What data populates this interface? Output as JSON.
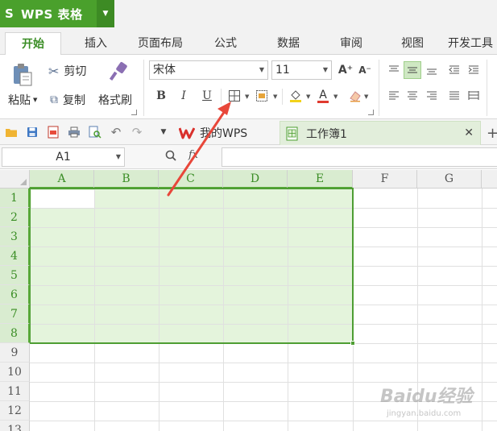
{
  "app": {
    "logo_glyph": "S",
    "name": "WPS 表格"
  },
  "tabs": [
    {
      "label": "开始",
      "active": true
    },
    {
      "label": "插入"
    },
    {
      "label": "页面布局"
    },
    {
      "label": "公式"
    },
    {
      "label": "数据"
    },
    {
      "label": "审阅"
    },
    {
      "label": "视图"
    },
    {
      "label": "开发工具"
    }
  ],
  "ribbon": {
    "paste": "粘贴",
    "cut": "剪切",
    "copy": "复制",
    "format_painter": "格式刷",
    "font_name": "宋体",
    "font_size": "11",
    "bold": "B",
    "italic": "I",
    "underline": "U",
    "font_color_glyph": "A",
    "grow_font": "A⁺",
    "shrink_font": "A⁻"
  },
  "doc_tabs": {
    "home": "我的WPS",
    "book": "工作簿1",
    "new_tab": "+"
  },
  "formula_bar": {
    "cell_ref": "A1",
    "fx": "fx",
    "value": ""
  },
  "grid": {
    "columns": [
      "A",
      "B",
      "C",
      "D",
      "E",
      "F",
      "G"
    ],
    "rows": [
      "1",
      "2",
      "3",
      "4",
      "5",
      "6",
      "7",
      "8",
      "9",
      "10",
      "11",
      "12",
      "13"
    ],
    "selection": "A1:E8",
    "active_cell": "A1"
  },
  "colors": {
    "accent": "#4aa02c",
    "selection_fill": "#e4f4dc",
    "selection_border": "#4e9e33",
    "arrow": "#e8473a"
  },
  "watermark": {
    "main": "Baidu经验",
    "sub": "jingyan.baidu.com"
  }
}
